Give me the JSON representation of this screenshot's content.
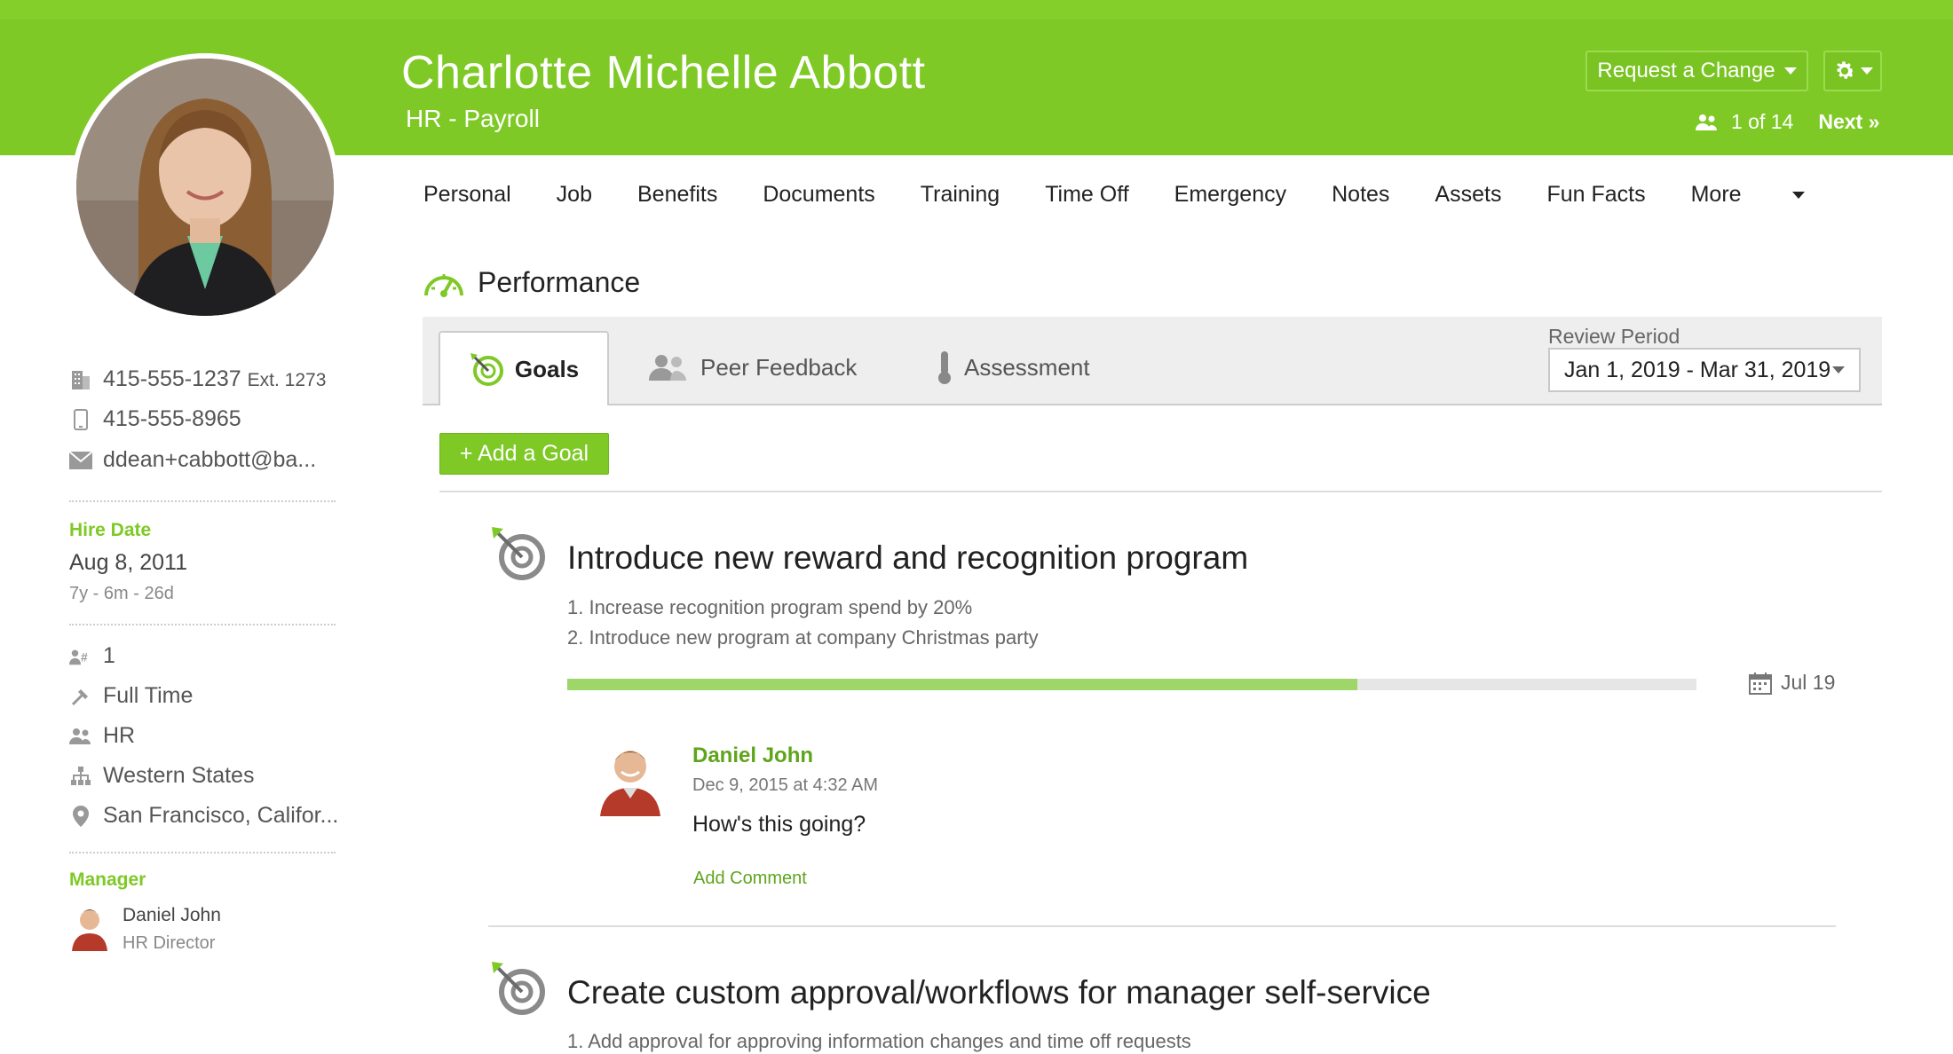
{
  "header": {
    "employee_name": "Charlotte Michelle Abbott",
    "department": "HR - Payroll",
    "request_change_label": "Request a Change",
    "pager_text": "1 of 14",
    "next_label": "Next »"
  },
  "contact": {
    "work_phone": "415-555-1237",
    "work_ext": "Ext. 1273",
    "mobile_phone": "415-555-8965",
    "email": "ddean+cabbott@ba..."
  },
  "hire": {
    "label": "Hire Date",
    "date": "Aug 8, 2011",
    "tenure": "7y - 6m - 26d"
  },
  "details": {
    "employee_number": "1",
    "employment_type": "Full Time",
    "department": "HR",
    "division": "Western States",
    "location": "San Francisco, Califor..."
  },
  "manager": {
    "label": "Manager",
    "name": "Daniel John",
    "title": "HR Director"
  },
  "nav": {
    "items": [
      "Personal",
      "Job",
      "Benefits",
      "Documents",
      "Training",
      "Time Off",
      "Emergency",
      "Notes",
      "Assets",
      "Fun Facts"
    ],
    "more_label": "More"
  },
  "performance": {
    "title": "Performance",
    "tabs": [
      "Goals",
      "Peer Feedback",
      "Assessment"
    ],
    "review_period_label": "Review Period",
    "review_period_value": "Jan 1, 2019 - Mar 31, 2019",
    "add_goal_label": "+ Add a Goal"
  },
  "goals": [
    {
      "title": "Introduce new reward and recognition program",
      "lines": [
        "1. Increase recognition program spend by 20%",
        "2. Introduce new program at company Christmas party"
      ],
      "progress": 0.7,
      "due": "Jul 19",
      "comment": {
        "author": "Daniel John",
        "date": "Dec 9, 2015 at 4:32 AM",
        "text": "How's this going?",
        "add_comment_label": "Add Comment"
      }
    },
    {
      "title": "Create custom approval/workflows for manager self-service",
      "lines": [
        "1. Add approval for approving information changes and time off requests"
      ]
    }
  ],
  "colors": {
    "brand_green": "#7ec926",
    "link_green": "#5ea51c",
    "progress_fill": "#9ed66a"
  }
}
